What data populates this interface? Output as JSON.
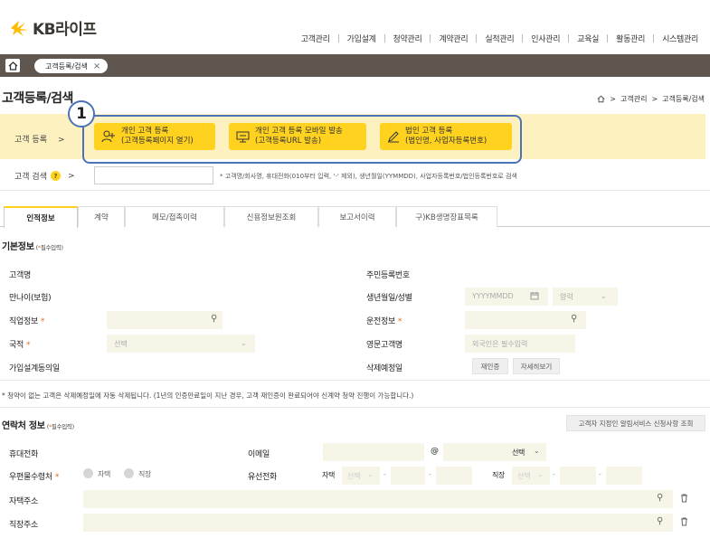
{
  "brand": {
    "logo_text": "KB라이프",
    "logo_color": "#ffbc00"
  },
  "nav": [
    "고객관리",
    "가입설계",
    "청약관리",
    "계약관리",
    "실적관리",
    "인사관리",
    "교육실",
    "활동관리",
    "시스템관리"
  ],
  "tab_chip": {
    "label": "고객등록/검색",
    "close": "×"
  },
  "page_title": "고객등록/검색",
  "breadcrumb": {
    "sep": ">",
    "items": [
      "고객관리",
      "고객등록/검색"
    ]
  },
  "annotation_number": "1",
  "register": {
    "label": "고객 등록",
    "arrow": ">",
    "buttons": [
      {
        "line1": "개인 고객 등록",
        "line2": "(고객등록페이지 열기)"
      },
      {
        "line1": "개인 고객 등록 모바일 발송",
        "line2": "(고객등록URL 발송)"
      },
      {
        "line1": "법인 고객 등록",
        "line2": "(법인명, 사업자등록번호)"
      }
    ]
  },
  "search": {
    "label": "고객 검색",
    "help": "?",
    "arrow": ">",
    "hint": "* 고객명/회사명, 휴대전화(010부터 입력, '-' 제외), 생년월일(YYMMDD), 사업자등록번호/법인등록번호로 검색"
  },
  "tabs": [
    "인적정보",
    "계약",
    "메모/접촉이력",
    "신용정보원조회",
    "보고서이력",
    "구)KB생명장표목록"
  ],
  "basic": {
    "title": "기본정보",
    "required_note_star": "*",
    "required_note": "필수입력",
    "customer_name": "고객명",
    "resident_no": "주민등록번호",
    "insurance_age": "만나이(보험)",
    "birth_gender": "생년월일/성별",
    "birth_placeholder": "YYYYMMDD",
    "gender_placeholder": "양력",
    "job": "직업정보",
    "driving": "운전정보",
    "nationality": "국적",
    "nationality_placeholder": "선택",
    "english_name": "영문고객명",
    "english_placeholder": "외국인은 필수입력",
    "consent": "가입설계동의일",
    "delete_date": "삭제예정일",
    "reconsent_btn": "재인증",
    "detail_btn": "자세히보기",
    "note": "* 청약이 없는 고객은 삭제예정일에 자동 삭제됩니다. (1년의 인증만료일이 지난 경우, 고객 재인증이 완료되어야 신계약 청약 진행이 가능합니다.)"
  },
  "contact": {
    "title": "연락처 정보",
    "required_note_star": "*",
    "required_note": "필수입력",
    "alarm_btn": "고객자 지정인 알림서비스 신청사항 조회",
    "mobile": "휴대전화",
    "email": "이메일",
    "at": "@",
    "email_select": "선택",
    "mail_recv": "우편물수령처",
    "home_opt": "자택",
    "work_opt": "직장",
    "landline": "유선전화",
    "home": "자택",
    "work": "직장",
    "select": "선택",
    "home_addr": "자택주소",
    "work_addr": "직장주소"
  }
}
